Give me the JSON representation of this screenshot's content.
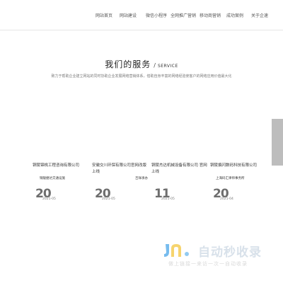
{
  "nav": {
    "items": [
      "网站首页",
      "网站建设",
      "微信小程序",
      "全网推广营销",
      "移动商营销",
      "成功案例",
      "关于企速"
    ]
  },
  "service": {
    "title_zh": "我们的服务",
    "separator": "/",
    "title_en": "SERVICE",
    "description": "致力于帮助企业建立网站的同时协助企业发展网络营销体系，借助自身丰富的网络经验使客户的网络应用价值最大化"
  },
  "cases": [
    {
      "title": "铜陵锦桃工程咨询有限公司",
      "subtitle": "铜陵捷达交通设施",
      "day": "20",
      "date": "2021-05"
    },
    {
      "title": "安徽交川环保有限公司官网改版上线",
      "subtitle": "",
      "day": "20",
      "date": "2021-05"
    },
    {
      "title": "铜陵杰达机械设备有限公司 官网上线",
      "subtitle": "吉祥承办",
      "day": "11",
      "date": "2021-05"
    },
    {
      "title": "铜陵撰闪数码科技有限公司",
      "subtitle": "上海码汇律师事务所",
      "day": "20",
      "date": "2021-04"
    }
  ],
  "watermark": {
    "title": "自动秒收录",
    "slogan": "做上链接一来访一次一自动收录",
    "colors": {
      "blue": "#4aa6e8",
      "yellow": "#f2c230",
      "grey": "#d8e1ea"
    }
  }
}
